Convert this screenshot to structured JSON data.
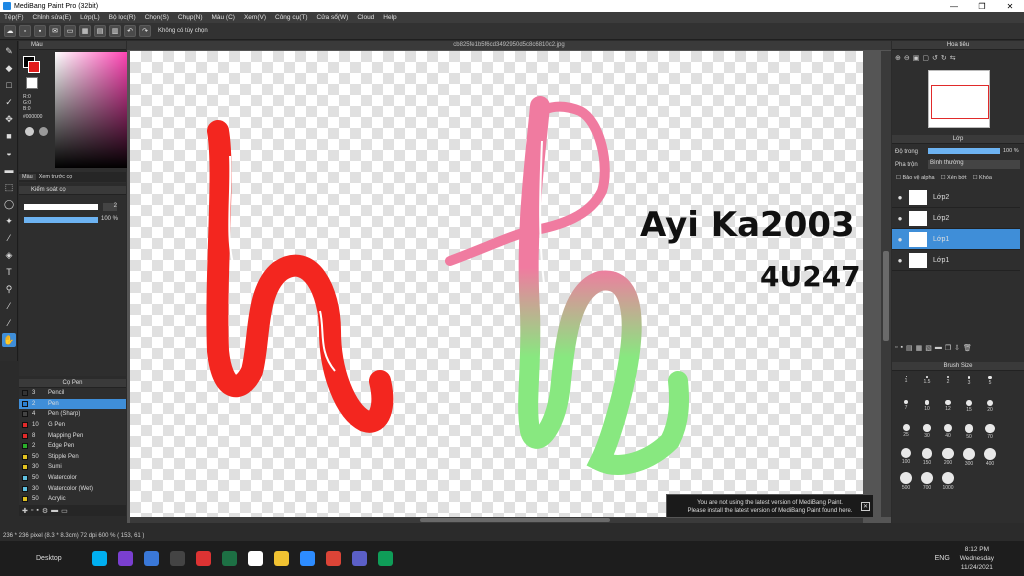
{
  "window": {
    "title": "MediBang Paint Pro (32bit)",
    "minimize": "—",
    "restore": "❐",
    "close": "✕"
  },
  "menu": [
    "Tệp(F)",
    "Chỉnh sửa(E)",
    "Lớp(L)",
    "Bộ lọc(R)",
    "Chọn(S)",
    "Chụp(N)",
    "Màu (C)",
    "Xem(V)",
    "Công cụ(T)",
    "Cửa sổ(W)",
    "Cloud",
    "Help"
  ],
  "toolbar": {
    "selection_text": "Không có tùy chọn"
  },
  "color_panel": {
    "title": "Màu",
    "r": "R:0",
    "g": "G:0",
    "b": "B:0",
    "hex": "#000000",
    "tab1": "Màu",
    "tab2": "Xem trước cọ"
  },
  "brush_control": {
    "title": "Kiểm soát cọ",
    "size_value": "2",
    "opacity_value": "100 %"
  },
  "pen_panel": {
    "title": "Cọ Pen",
    "items": [
      {
        "size": "3",
        "name": "Pencil",
        "color": "#333333"
      },
      {
        "size": "2",
        "name": "Pen",
        "color": "#2a7fd0"
      },
      {
        "size": "4",
        "name": "Pen (Sharp)",
        "color": "#444444"
      },
      {
        "size": "10",
        "name": "G Pen",
        "color": "#e02a2a"
      },
      {
        "size": "8",
        "name": "Mapping Pen",
        "color": "#e02a2a"
      },
      {
        "size": "2",
        "name": "Edge Pen",
        "color": "#2ab02a"
      },
      {
        "size": "50",
        "name": "Stipple Pen",
        "color": "#e0c020"
      },
      {
        "size": "30",
        "name": "Sumi",
        "color": "#e0c020"
      },
      {
        "size": "50",
        "name": "Watercolor",
        "color": "#60c0e0"
      },
      {
        "size": "30",
        "name": "Watercolor (Wet)",
        "color": "#60c0e0"
      },
      {
        "size": "50",
        "name": "Acrylic",
        "color": "#e0c020"
      },
      {
        "size": "100",
        "name": "Airbrush",
        "color": "#e0c020"
      }
    ]
  },
  "canvas": {
    "filename": "cb825fe1b5f6cd3492950d5c8c6810c2.jpg",
    "text_line1": "Ayi Ka2003",
    "text_line2": "4U247"
  },
  "navigator": {
    "title": "Hoa tiêu"
  },
  "layers": {
    "title": "Lớp",
    "opacity_label": "Độ trong",
    "opacity_value": "100 %",
    "blend_label": "Pha trộn",
    "blend_value": "Bình thường",
    "protect_alpha": "Bảo vệ alpha",
    "clipping": "Xén bớt",
    "lock": "Khóa",
    "items": [
      {
        "name": "Lớp2",
        "selected": false
      },
      {
        "name": "Lớp2",
        "selected": false
      },
      {
        "name": "Lớp1",
        "selected": true
      },
      {
        "name": "Lớp1",
        "selected": false
      }
    ]
  },
  "brush_size": {
    "title": "Brush Size",
    "sizes": [
      "1",
      "1.5",
      "2",
      "3",
      "5",
      "7",
      "10",
      "12",
      "15",
      "20",
      "25",
      "30",
      "40",
      "50",
      "70",
      "100",
      "150",
      "200",
      "300",
      "400",
      "500",
      "700",
      "1000"
    ]
  },
  "notice": {
    "line1": "You are not using the latest version of MediBang Paint.",
    "line2": "Please install the latest version of MediBang Paint found here."
  },
  "status": {
    "text": "236 * 236 pixel   (8.3 * 8.3cm)   72 dpi   600 %   ( 153, 61 )"
  },
  "taskbar": {
    "desktop": "Desktop",
    "lang": "ENG",
    "time": "8:12 PM",
    "day": "Wednesday",
    "date": "11/24/2021"
  }
}
